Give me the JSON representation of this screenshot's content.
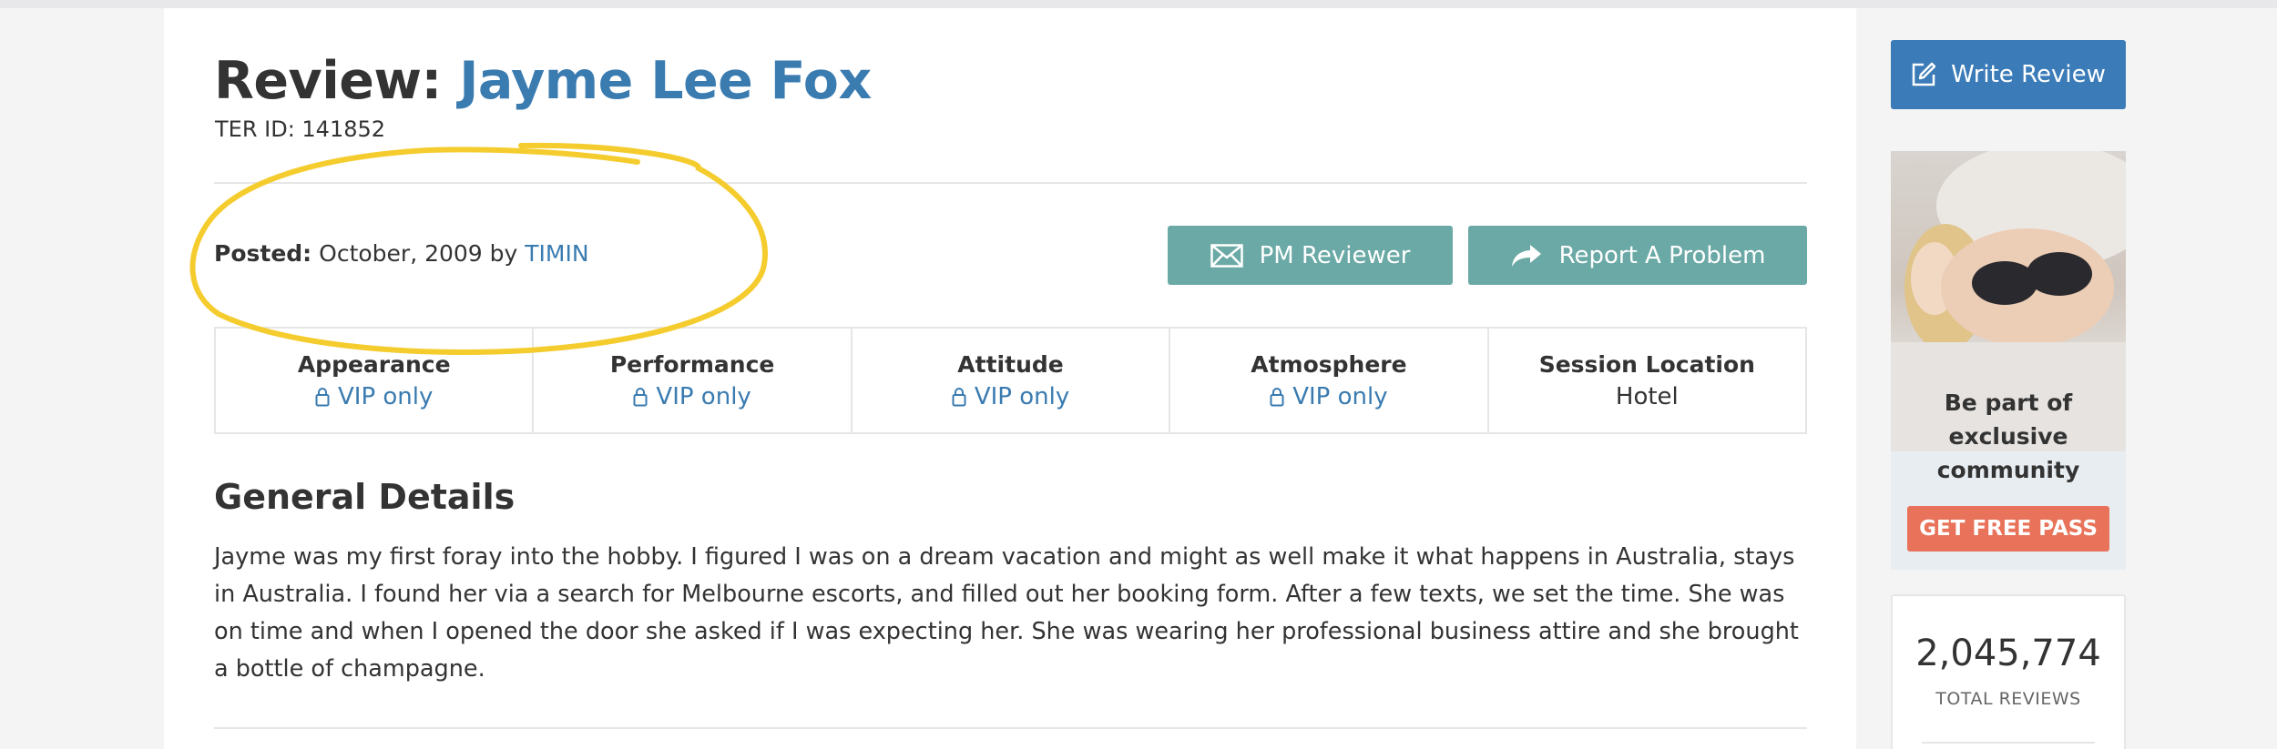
{
  "header": {
    "title_prefix": "Review:",
    "title_name": "Jayme Lee Fox",
    "ter_id": "TER ID: 141852"
  },
  "posted": {
    "label": "Posted:",
    "date_by": "October, 2009 by",
    "author": "TIMIN"
  },
  "actions": {
    "pm_label": "PM Reviewer",
    "report_label": "Report A Problem"
  },
  "ratings": [
    {
      "label": "Appearance",
      "value": "VIP only",
      "locked": true
    },
    {
      "label": "Performance",
      "value": "VIP only",
      "locked": true
    },
    {
      "label": "Attitude",
      "value": "VIP only",
      "locked": true
    },
    {
      "label": "Atmosphere",
      "value": "VIP only",
      "locked": true
    },
    {
      "label": "Session Location",
      "value": "Hotel",
      "locked": false
    }
  ],
  "details": {
    "title": "General Details",
    "text": "Jayme was my first foray into the hobby. I figured I was on a dream vacation and might as well make it what happens in Australia, stays in Australia. I found her via a search for Melbourne escorts, and filled out her booking form. After a few texts, we set the time. She was on time and when I opened the door she asked if I was expecting her. She was wearing her professional business attire and she brought a bottle of champagne."
  },
  "sidebar": {
    "write_review_label": "Write Review",
    "promo_text": "Be part of exclusive community",
    "promo_button": "GET FREE PASS",
    "stats_number": "2,045,774",
    "stats_label": "TOTAL REVIEWS"
  },
  "colors": {
    "link": "#3a7bb0",
    "teal_button": "#6aa9a5",
    "primary_button": "#3a7bb8",
    "promo_button": "#e8735a",
    "highlight_circle": "#f5cc2e"
  }
}
